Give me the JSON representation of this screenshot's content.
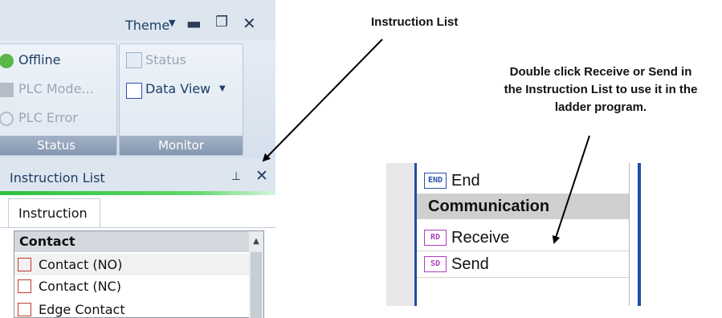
{
  "app": {
    "theme_label": "Theme",
    "ribbon": {
      "status_group": {
        "items": [
          "Offline",
          "PLC Mode...",
          "PLC Error"
        ],
        "label": "Status"
      },
      "monitor_group": {
        "items": [
          "Status",
          "Data View"
        ],
        "label": "Monitor"
      }
    },
    "instruction_list": {
      "title": "Instruction List",
      "tab": "Instruction",
      "category": "Contact",
      "items": [
        "Contact (NO)",
        "Contact (NC)",
        "Edge Contact"
      ]
    }
  },
  "annotations": {
    "instruction_list": "Instruction List",
    "description_lines": [
      "Double click Receive or Send in",
      "the Instruction List to use it in the",
      "ladder program."
    ]
  },
  "zoom_panel": {
    "rows": [
      {
        "badge": "END",
        "label": "End"
      },
      {
        "badge": "",
        "label": "Communication"
      },
      {
        "badge": "RD",
        "label": "Receive"
      },
      {
        "badge": "SD",
        "label": "Send"
      }
    ]
  },
  "colors": {
    "ribbon_bg": "#dde5ef",
    "accent_green": "#2fbf3f",
    "zoom_border": "#1f4ea8",
    "badge_end": "#2a4fa8",
    "badge_comm": "#b03fc0"
  }
}
